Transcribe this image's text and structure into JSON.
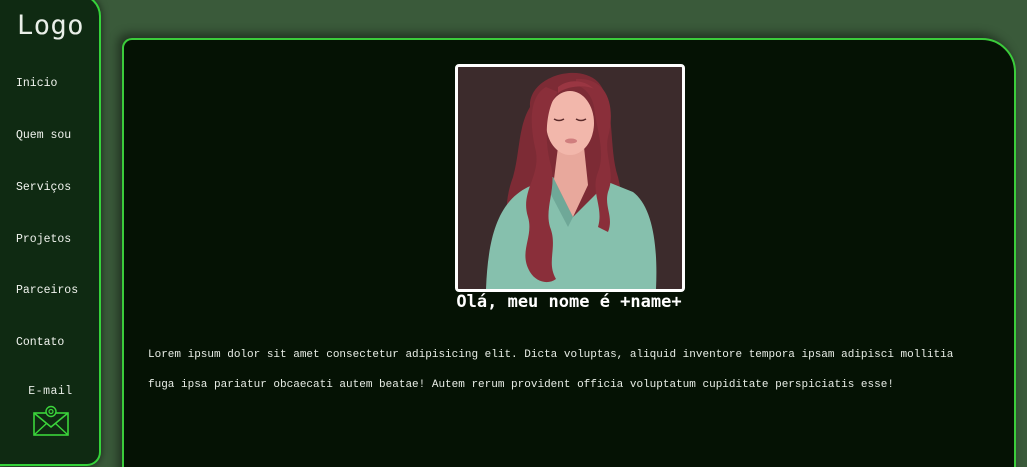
{
  "sidebar": {
    "logo": "Logo",
    "items": [
      {
        "label": "Inicio"
      },
      {
        "label": "Quem sou"
      },
      {
        "label": "Serviços"
      },
      {
        "label": "Projetos"
      },
      {
        "label": "Parceiros"
      },
      {
        "label": "Contato"
      }
    ],
    "email_label": "E-mail",
    "email_icon": "envelope-at-icon"
  },
  "main": {
    "profile_image": "woman-portrait-illustration",
    "greeting": "Olá, meu nome é +name+",
    "bio": "Lorem ipsum dolor sit amet consectetur adipisicing elit. Dicta voluptas, aliquid inventore tempora ipsam adipisci mollitia fuga ipsa pariatur obcaecati autem beatae! Autem rerum provident officia voluptatum cupiditate perspiciatis esse!"
  },
  "colors": {
    "background": "#3a5a3a",
    "accent_green": "#35d23a",
    "sidebar_bg": "#0f2a12",
    "main_bg": "#051204",
    "text": "#ffffff"
  }
}
